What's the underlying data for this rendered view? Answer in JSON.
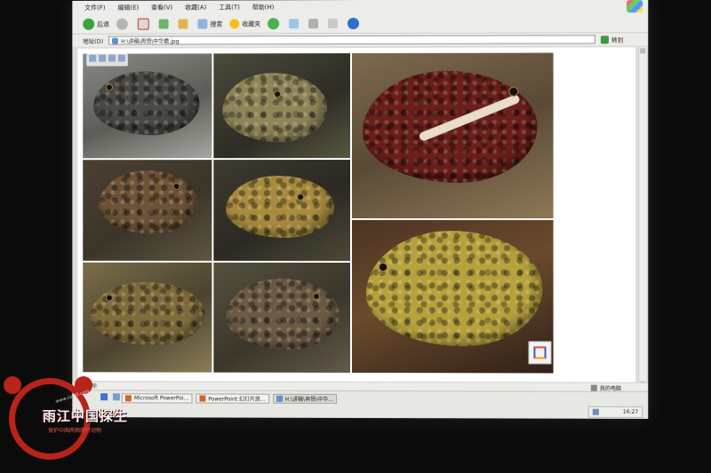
{
  "menu": {
    "items": [
      "文件(F)",
      "编辑(E)",
      "查看(V)",
      "收藏(A)",
      "工具(T)",
      "帮助(H)"
    ]
  },
  "toolbar": {
    "back_label": "后退",
    "search_label": "搜索",
    "favorites_label": "收藏夹"
  },
  "address": {
    "label": "地址(D)",
    "value": "H:\\讲稿\\再悟\\中华蟾.jpg",
    "go_label": "转到"
  },
  "status": {
    "left_text": "完毕",
    "right_text": "我的电脑"
  },
  "taskbar": {
    "tasks": [
      {
        "label": "Microsoft PowerPoi..."
      },
      {
        "label": "PowerPoint 幻灯片放..."
      },
      {
        "label": "H:\\讲稿\\再悟\\中华..."
      }
    ],
    "clock": "16:27"
  },
  "watermark": {
    "title": "雨江中国探生",
    "url": "www.cohl0.com",
    "subtitle": "保护中国两栖爬行动物"
  },
  "colors": {
    "watermark_red": "#b8241a",
    "screen_bg": "#dcdcd8",
    "room_bg": "#0b0b0b"
  }
}
